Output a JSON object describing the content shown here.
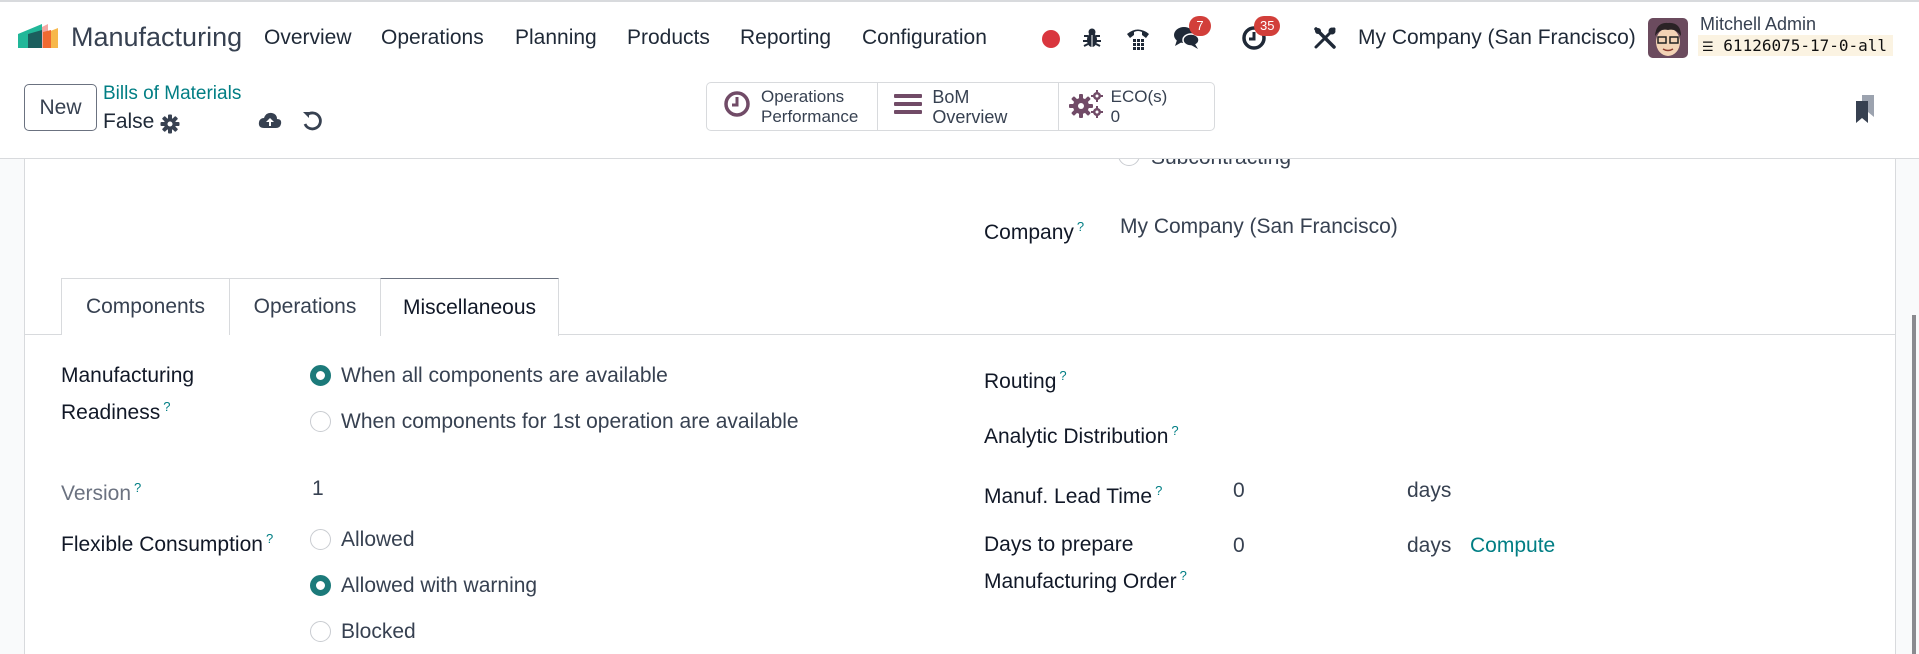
{
  "navbar": {
    "app_name": "Manufacturing",
    "menu": [
      "Overview",
      "Operations",
      "Planning",
      "Products",
      "Reporting",
      "Configuration"
    ],
    "icons": [
      "recording-dot-icon",
      "bug-icon",
      "phone-icon",
      "chat-icon",
      "activity-clock-icon",
      "tools-icon"
    ],
    "messages_badge": "7",
    "activities_badge": "35",
    "company": "My Company (San Francisco)",
    "user_name": "Mitchell Admin",
    "database": "61126075-17-0-all"
  },
  "control_panel": {
    "new_label": "New",
    "breadcrumb": "Bills of Materials",
    "record_name": "False",
    "smart_buttons": [
      {
        "icon": "clock-icon",
        "line1": "Operations",
        "line2": "Performance"
      },
      {
        "icon": "bars-icon",
        "line1": "BoM Overview",
        "line2": ""
      },
      {
        "icon": "cogs-icon",
        "line1": "ECO(s)",
        "line2": "0"
      }
    ]
  },
  "form": {
    "bom_type_option_partial": "Subcontracting",
    "company_label": "Company",
    "company_value": "My Company (San Francisco)",
    "tabs": [
      {
        "label": "Components",
        "active": false
      },
      {
        "label": "Operations",
        "active": false
      },
      {
        "label": "Miscellaneous",
        "active": true
      }
    ],
    "help_mark": "?",
    "left": {
      "readiness_label_line1": "Manufacturing",
      "readiness_label_line2": "Readiness",
      "readiness_options": [
        {
          "label": "When all components are available",
          "checked": true
        },
        {
          "label": "When components for 1st operation are available",
          "checked": false
        }
      ],
      "version_label": "Version",
      "version_value": "1",
      "flexible_label": "Flexible Consumption",
      "flexible_options": [
        {
          "label": "Allowed",
          "checked": false
        },
        {
          "label": "Allowed with warning",
          "checked": true
        },
        {
          "label": "Blocked",
          "checked": false
        }
      ]
    },
    "right": {
      "routing_label": "Routing",
      "analytic_label": "Analytic Distribution",
      "lead_time_label": "Manuf. Lead Time",
      "lead_time_value": "0",
      "lead_time_unit": "days",
      "prepare_label_line1": "Days to prepare",
      "prepare_label_line2": "Manufacturing Order",
      "prepare_value": "0",
      "prepare_unit": "days",
      "compute_label": "Compute"
    }
  }
}
